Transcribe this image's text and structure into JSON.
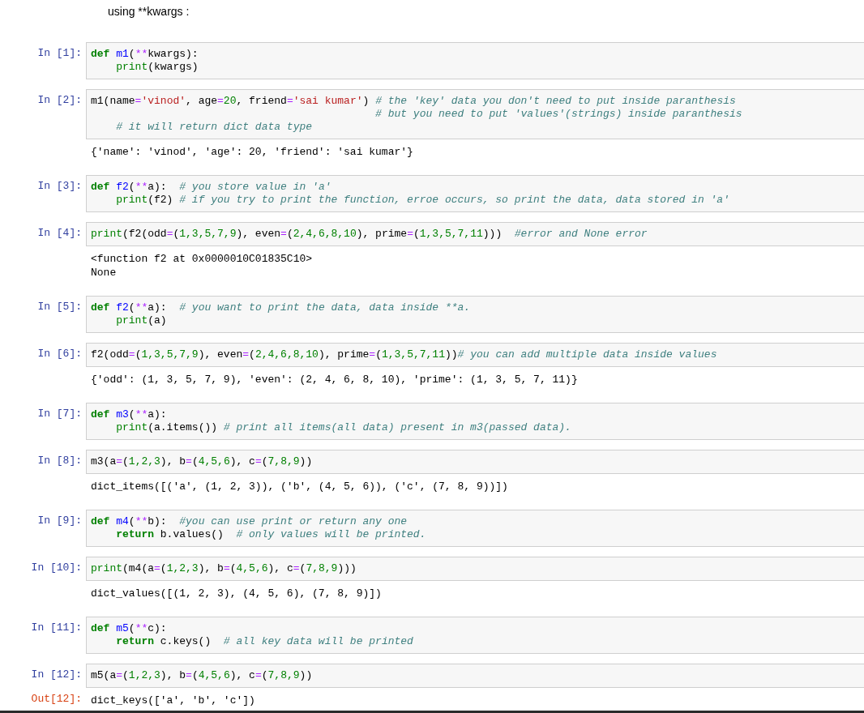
{
  "cells": [
    {
      "kind": "markdown",
      "text": "using **kwargs :"
    },
    {
      "kind": "code",
      "prompt": "In [1]:",
      "lines": [
        [
          {
            "kind": "kw",
            "text": "def "
          },
          {
            "kind": "fn",
            "text": "m1"
          },
          {
            "kind": "plain",
            "text": "("
          },
          {
            "kind": "op",
            "text": "**"
          },
          {
            "kind": "plain",
            "text": "kwargs):"
          }
        ],
        [
          {
            "kind": "builtin",
            "text": "    print"
          },
          {
            "kind": "plain",
            "text": "(kwargs)"
          }
        ]
      ]
    },
    {
      "kind": "code",
      "prompt": "In [2]:",
      "lines": [
        [
          {
            "kind": "plain",
            "text": "m1(name"
          },
          {
            "kind": "op",
            "text": "="
          },
          {
            "kind": "str",
            "text": "'vinod'"
          },
          {
            "kind": "plain",
            "text": ", age"
          },
          {
            "kind": "op",
            "text": "="
          },
          {
            "kind": "num",
            "text": "20"
          },
          {
            "kind": "plain",
            "text": ", friend"
          },
          {
            "kind": "op",
            "text": "="
          },
          {
            "kind": "str",
            "text": "'sai kumar'"
          },
          {
            "kind": "plain",
            "text": ") "
          },
          {
            "kind": "comment",
            "text": "# the 'key' data you don't need to put inside paranthesis"
          }
        ],
        [
          {
            "kind": "comment",
            "text": "                                             # but you need to put 'values'(strings) inside paranthesis"
          }
        ],
        [
          {
            "kind": "comment",
            "text": "    # it will return dict data type"
          }
        ]
      ],
      "output": {
        "lines": [
          "{'name': 'vinod', 'age': 20, 'friend': 'sai kumar'}"
        ]
      }
    },
    {
      "kind": "code",
      "prompt": "In [3]:",
      "lines": [
        [
          {
            "kind": "kw",
            "text": "def "
          },
          {
            "kind": "fn",
            "text": "f2"
          },
          {
            "kind": "plain",
            "text": "("
          },
          {
            "kind": "op",
            "text": "**"
          },
          {
            "kind": "plain",
            "text": "a):  "
          },
          {
            "kind": "comment",
            "text": "# you store value in 'a'"
          }
        ],
        [
          {
            "kind": "builtin",
            "text": "    print"
          },
          {
            "kind": "plain",
            "text": "(f2) "
          },
          {
            "kind": "comment",
            "text": "# if you try to print the function, erroe occurs, so print the data, data stored in 'a'"
          }
        ]
      ]
    },
    {
      "kind": "code",
      "prompt": "In [4]:",
      "lines": [
        [
          {
            "kind": "builtin",
            "text": "print"
          },
          {
            "kind": "plain",
            "text": "(f2(odd"
          },
          {
            "kind": "op",
            "text": "="
          },
          {
            "kind": "plain",
            "text": "("
          },
          {
            "kind": "num",
            "text": "1,3,5,7,9"
          },
          {
            "kind": "plain",
            "text": "), even"
          },
          {
            "kind": "op",
            "text": "="
          },
          {
            "kind": "plain",
            "text": "("
          },
          {
            "kind": "num",
            "text": "2,4,6,8,10"
          },
          {
            "kind": "plain",
            "text": "), prime"
          },
          {
            "kind": "op",
            "text": "="
          },
          {
            "kind": "plain",
            "text": "("
          },
          {
            "kind": "num",
            "text": "1,3,5,7,11"
          },
          {
            "kind": "plain",
            "text": ")))  "
          },
          {
            "kind": "comment",
            "text": "#error and None error"
          }
        ]
      ],
      "output": {
        "lines": [
          "<function f2 at 0x0000010C01835C10>",
          "None"
        ]
      }
    },
    {
      "kind": "code",
      "prompt": "In [5]:",
      "lines": [
        [
          {
            "kind": "kw",
            "text": "def "
          },
          {
            "kind": "fn",
            "text": "f2"
          },
          {
            "kind": "plain",
            "text": "("
          },
          {
            "kind": "op",
            "text": "**"
          },
          {
            "kind": "plain",
            "text": "a):  "
          },
          {
            "kind": "comment",
            "text": "# you want to print the data, data inside **a."
          }
        ],
        [
          {
            "kind": "builtin",
            "text": "    print"
          },
          {
            "kind": "plain",
            "text": "(a)"
          }
        ]
      ]
    },
    {
      "kind": "code",
      "prompt": "In [6]:",
      "lines": [
        [
          {
            "kind": "plain",
            "text": "f2(odd"
          },
          {
            "kind": "op",
            "text": "="
          },
          {
            "kind": "plain",
            "text": "("
          },
          {
            "kind": "num",
            "text": "1,3,5,7,9"
          },
          {
            "kind": "plain",
            "text": "), even"
          },
          {
            "kind": "op",
            "text": "="
          },
          {
            "kind": "plain",
            "text": "("
          },
          {
            "kind": "num",
            "text": "2,4,6,8,10"
          },
          {
            "kind": "plain",
            "text": "), prime"
          },
          {
            "kind": "op",
            "text": "="
          },
          {
            "kind": "plain",
            "text": "("
          },
          {
            "kind": "num",
            "text": "1,3,5,7,11"
          },
          {
            "kind": "plain",
            "text": "))"
          },
          {
            "kind": "comment",
            "text": "# you can add multiple data inside values"
          }
        ]
      ],
      "output": {
        "lines": [
          "{'odd': (1, 3, 5, 7, 9), 'even': (2, 4, 6, 8, 10), 'prime': (1, 3, 5, 7, 11)}"
        ]
      }
    },
    {
      "kind": "code",
      "prompt": "In [7]:",
      "lines": [
        [
          {
            "kind": "kw",
            "text": "def "
          },
          {
            "kind": "fn",
            "text": "m3"
          },
          {
            "kind": "plain",
            "text": "("
          },
          {
            "kind": "op",
            "text": "**"
          },
          {
            "kind": "plain",
            "text": "a):"
          }
        ],
        [
          {
            "kind": "builtin",
            "text": "    print"
          },
          {
            "kind": "plain",
            "text": "(a.items()) "
          },
          {
            "kind": "comment",
            "text": "# print all items(all data) present in m3(passed data)."
          }
        ]
      ]
    },
    {
      "kind": "code",
      "prompt": "In [8]:",
      "lines": [
        [
          {
            "kind": "plain",
            "text": "m3(a"
          },
          {
            "kind": "op",
            "text": "="
          },
          {
            "kind": "plain",
            "text": "("
          },
          {
            "kind": "num",
            "text": "1,2,3"
          },
          {
            "kind": "plain",
            "text": "), b"
          },
          {
            "kind": "op",
            "text": "="
          },
          {
            "kind": "plain",
            "text": "("
          },
          {
            "kind": "num",
            "text": "4,5,6"
          },
          {
            "kind": "plain",
            "text": "), c"
          },
          {
            "kind": "op",
            "text": "="
          },
          {
            "kind": "plain",
            "text": "("
          },
          {
            "kind": "num",
            "text": "7,8,9"
          },
          {
            "kind": "plain",
            "text": "))"
          }
        ]
      ],
      "output": {
        "lines": [
          "dict_items([('a', (1, 2, 3)), ('b', (4, 5, 6)), ('c', (7, 8, 9))])"
        ]
      }
    },
    {
      "kind": "code",
      "prompt": "In [9]:",
      "lines": [
        [
          {
            "kind": "kw",
            "text": "def "
          },
          {
            "kind": "fn",
            "text": "m4"
          },
          {
            "kind": "plain",
            "text": "("
          },
          {
            "kind": "op",
            "text": "**"
          },
          {
            "kind": "plain",
            "text": "b):  "
          },
          {
            "kind": "comment",
            "text": "#you can use print or return any one"
          }
        ],
        [
          {
            "kind": "kw",
            "text": "    return"
          },
          {
            "kind": "plain",
            "text": " b.values()  "
          },
          {
            "kind": "comment",
            "text": "# only values will be printed."
          }
        ]
      ]
    },
    {
      "kind": "code",
      "prompt": "In [10]:",
      "lines": [
        [
          {
            "kind": "builtin",
            "text": "print"
          },
          {
            "kind": "plain",
            "text": "(m4(a"
          },
          {
            "kind": "op",
            "text": "="
          },
          {
            "kind": "plain",
            "text": "("
          },
          {
            "kind": "num",
            "text": "1,2,3"
          },
          {
            "kind": "plain",
            "text": "), b"
          },
          {
            "kind": "op",
            "text": "="
          },
          {
            "kind": "plain",
            "text": "("
          },
          {
            "kind": "num",
            "text": "4,5,6"
          },
          {
            "kind": "plain",
            "text": "), c"
          },
          {
            "kind": "op",
            "text": "="
          },
          {
            "kind": "plain",
            "text": "("
          },
          {
            "kind": "num",
            "text": "7,8,9"
          },
          {
            "kind": "plain",
            "text": ")))"
          }
        ]
      ],
      "output": {
        "lines": [
          "dict_values([(1, 2, 3), (4, 5, 6), (7, 8, 9)])"
        ]
      }
    },
    {
      "kind": "code",
      "prompt": "In [11]:",
      "lines": [
        [
          {
            "kind": "kw",
            "text": "def "
          },
          {
            "kind": "fn",
            "text": "m5"
          },
          {
            "kind": "plain",
            "text": "("
          },
          {
            "kind": "op",
            "text": "**"
          },
          {
            "kind": "plain",
            "text": "c):"
          }
        ],
        [
          {
            "kind": "kw",
            "text": "    return"
          },
          {
            "kind": "plain",
            "text": " c.keys()  "
          },
          {
            "kind": "comment",
            "text": "# all key data will be printed"
          }
        ]
      ]
    },
    {
      "kind": "code",
      "prompt": "In [12]:",
      "lines": [
        [
          {
            "kind": "plain",
            "text": "m5(a"
          },
          {
            "kind": "op",
            "text": "="
          },
          {
            "kind": "plain",
            "text": "("
          },
          {
            "kind": "num",
            "text": "1,2,3"
          },
          {
            "kind": "plain",
            "text": "), b"
          },
          {
            "kind": "op",
            "text": "="
          },
          {
            "kind": "plain",
            "text": "("
          },
          {
            "kind": "num",
            "text": "4,5,6"
          },
          {
            "kind": "plain",
            "text": "), c"
          },
          {
            "kind": "op",
            "text": "="
          },
          {
            "kind": "plain",
            "text": "("
          },
          {
            "kind": "num",
            "text": "7,8,9"
          },
          {
            "kind": "plain",
            "text": "))"
          }
        ]
      ],
      "output": {
        "prompt": "Out[12]:",
        "lines": [
          "dict_keys(['a', 'b', 'c'])"
        ]
      }
    }
  ]
}
